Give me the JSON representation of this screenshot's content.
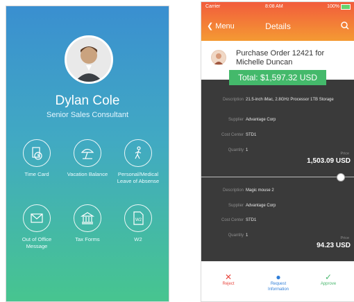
{
  "left_screen": {
    "profile": {
      "name": "Dylan Cole",
      "title": "Senior Sales Consultant"
    },
    "tiles": [
      {
        "label": "Time Card",
        "icon": "time-card-icon"
      },
      {
        "label": "Vacation Balance",
        "icon": "beach-umbrella-icon"
      },
      {
        "label": "Personal/Medical Leave of Absense",
        "icon": "walking-person-icon"
      },
      {
        "label": "Out of Office Message",
        "icon": "mail-icon"
      },
      {
        "label": "Tax Forms",
        "icon": "building-icon"
      },
      {
        "label": "W2",
        "icon": "w2-document-icon",
        "badge": "W2"
      }
    ]
  },
  "right_screen": {
    "status_bar": {
      "carrier": "Carrier",
      "time": "8:08 AM",
      "battery": "100%"
    },
    "nav": {
      "back_label": "Menu",
      "title": "Details"
    },
    "order": {
      "title": "Purchase Order 12421 for Michelle Duncan",
      "total": "Total: $1,597.32 USD"
    },
    "items": [
      {
        "description_label": "Description",
        "description": "21.5-inch iMac, 2.8GHz Processor 1TB Storage",
        "supplier_label": "Supplier",
        "supplier": "Advantage Corp",
        "cost_center_label": "Cost Center",
        "cost_center": "STD1",
        "quantity_label": "Quantity",
        "quantity": "1",
        "price_label": "Price",
        "price": "1,503.09 USD"
      },
      {
        "description_label": "Description",
        "description": "Magic mouse 2",
        "supplier_label": "Supplier",
        "supplier": "Advantage Corp",
        "cost_center_label": "Cost Center",
        "cost_center": "STD1",
        "quantity_label": "Quantity",
        "quantity": "1",
        "price_label": "Price",
        "price": "94.23 USD"
      }
    ],
    "actions": {
      "reject": "Reject",
      "request": "Request Information",
      "approve": "Approve"
    },
    "colors": {
      "header_start": "#f25c3c",
      "header_end": "#f49a33",
      "total_bg": "#44b96b",
      "reject": "#e8453c",
      "request": "#2f7ed8",
      "approve": "#4ab86f"
    }
  }
}
